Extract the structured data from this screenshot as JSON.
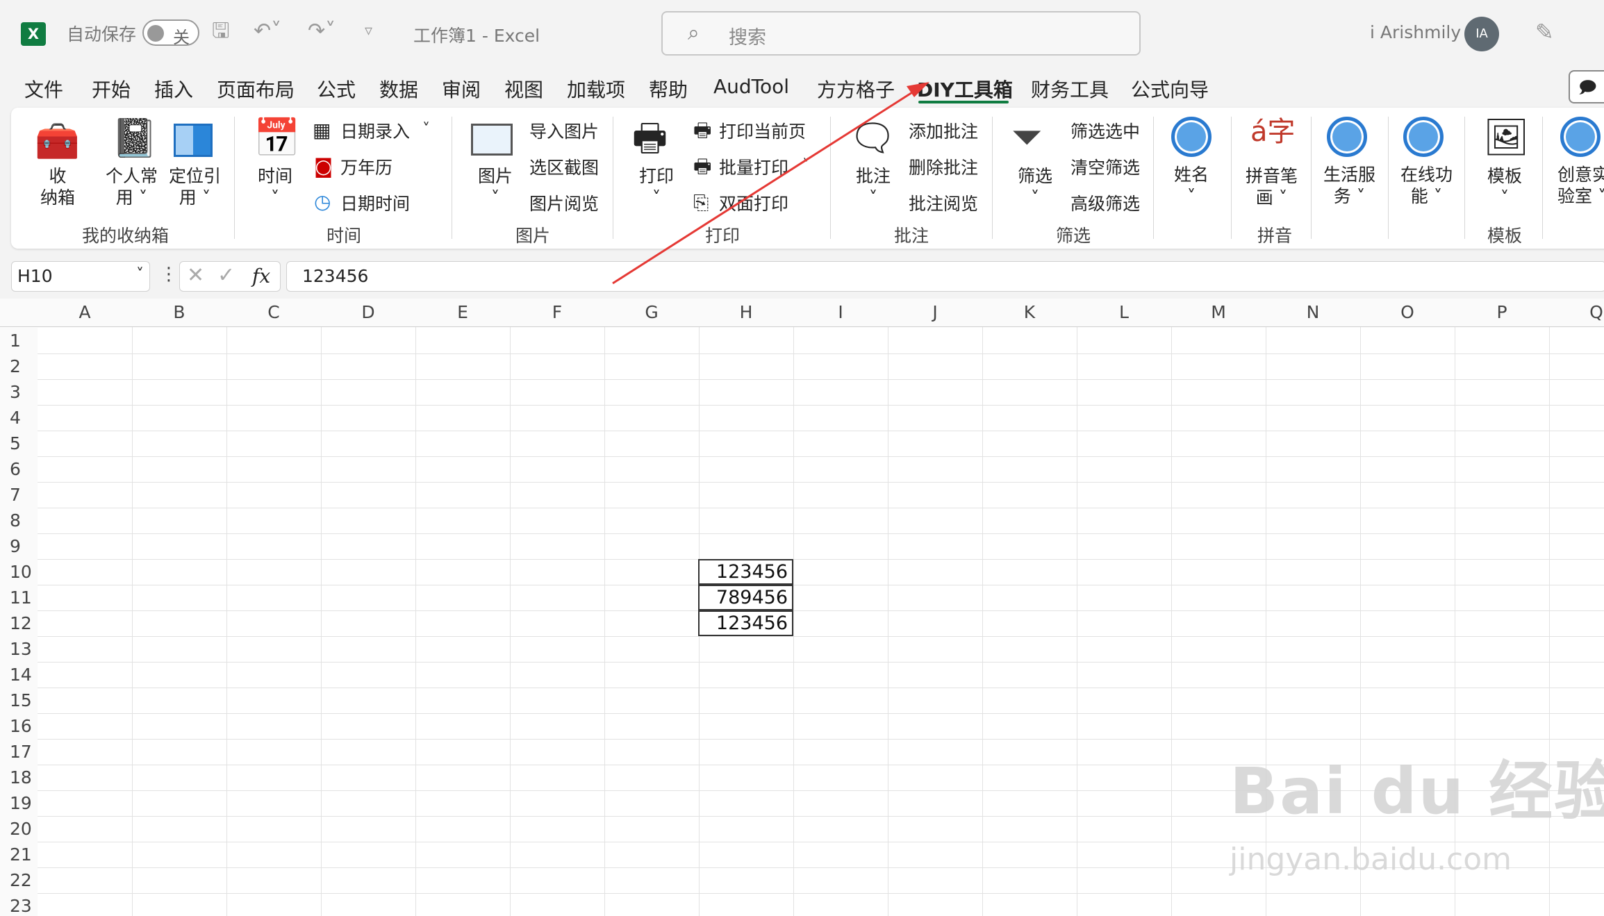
{
  "titlebar": {
    "autosave_label": "自动保存",
    "autosave_state": "关",
    "doc_title": "工作簿1  -  Excel",
    "search_placeholder": "搜索",
    "user_name": "i Arishmily",
    "user_initials": "IA"
  },
  "tabs": [
    "文件",
    "开始",
    "插入",
    "页面布局",
    "公式",
    "数据",
    "审阅",
    "视图",
    "加载项",
    "帮助",
    "AudTool",
    "方方格子",
    "DIY工具箱",
    "财务工具",
    "公式向导"
  ],
  "active_tab": "DIY工具箱",
  "ribbon": {
    "storage": {
      "btn1": "收\n纳箱",
      "btn2": "个人常\n用 ˅",
      "btn3": "定位引\n用 ˅",
      "group": "我的收纳箱"
    },
    "time": {
      "main": "时间\n˅",
      "item1": "日期录入",
      "item2": "万年历",
      "item3": "日期时间",
      "group": "时间"
    },
    "picture": {
      "main": "图片\n˅",
      "item1": "导入图片",
      "item2": "选区截图",
      "item3": "图片阅览",
      "group": "图片"
    },
    "print": {
      "main": "打印\n˅",
      "item1": "打印当前页",
      "item2": "批量打印",
      "item3": "双面打印",
      "group": "打印"
    },
    "comment": {
      "main": "批注\n˅",
      "item1": "添加批注",
      "item2": "删除批注",
      "item3": "批注阅览",
      "group": "批注"
    },
    "filter": {
      "main": "筛选\n˅",
      "item1": "筛选选中",
      "item2": "清空筛选",
      "item3": "高级筛选",
      "group": "筛选"
    },
    "name": {
      "main": "姓名\n˅"
    },
    "pinyin": {
      "main": "拼音笔\n画 ˅",
      "group": "拼音"
    },
    "life": {
      "main": "生活服\n务 ˅"
    },
    "online": {
      "main": "在线功\n能 ˅"
    },
    "template": {
      "main": "模板\n˅",
      "group": "模板"
    },
    "creative": {
      "main": "创意实\n验室 ˅"
    }
  },
  "formula_bar": {
    "name_box": "H10",
    "fx": "fx",
    "value": "123456"
  },
  "columns": [
    "A",
    "B",
    "C",
    "D",
    "E",
    "F",
    "G",
    "H",
    "I",
    "J",
    "K",
    "L",
    "M",
    "N",
    "O",
    "P",
    "Q"
  ],
  "rows": [
    "1",
    "2",
    "3",
    "4",
    "5",
    "6",
    "7",
    "8",
    "9",
    "10",
    "11",
    "12",
    "13",
    "14",
    "15",
    "16",
    "17",
    "18",
    "19",
    "20",
    "21",
    "22",
    "23"
  ],
  "cells": [
    {
      "ref": "H10",
      "value": "123456"
    },
    {
      "ref": "H11",
      "value": "789456"
    },
    {
      "ref": "H12",
      "value": "123456"
    }
  ],
  "watermark": {
    "main": "Bai du 经验",
    "sub": "jingyan.baidu.com"
  },
  "colors": {
    "excel_green": "#107c41",
    "annotation_arrow": "#e53935"
  }
}
